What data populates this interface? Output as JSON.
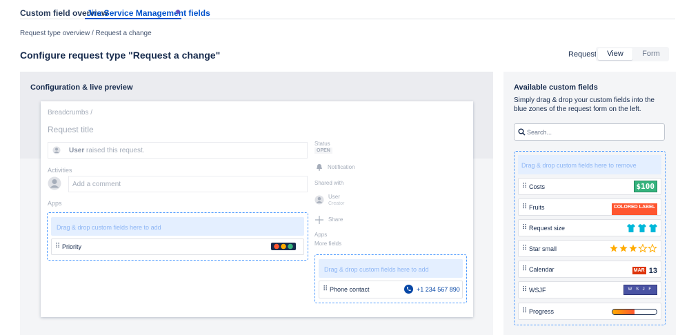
{
  "tabs": {
    "overview": "Custom field overview",
    "jsm": "Jira Service Management fields"
  },
  "breadcrumb": "Request type overview / Request a change",
  "page_title": "Configure request type \"Request a change\"",
  "request_toggle": {
    "label": "Request:",
    "view": "View",
    "form": "Form"
  },
  "config": {
    "title": "Configuration & live preview",
    "preview": {
      "breadcrumbs": "Breadcrumbs /",
      "request_title": "Request title",
      "user_name": "User",
      "user_action": " raised this request.",
      "activities": "Activities",
      "comment_placeholder": "Add a comment",
      "apps": "Apps",
      "dropzone_hint": "Drag & drop custom fields here to add",
      "priority_field": "Priority",
      "status_label": "Status",
      "status_value": "OPEN",
      "notification": "Notification",
      "shared_with": "Shared with",
      "shared_user": "User",
      "shared_role": "Creator",
      "share": "Share",
      "apps2": "Apps",
      "more_fields": "More fields",
      "side_dropzone_hint": "Drag & drop custom fields here to add",
      "phone_field": "Phone contact",
      "phone_value": "+1 234 567 890"
    }
  },
  "available": {
    "title": "Available custom fields",
    "description": "Simply drag & drop your custom fields into the blue zones of the request form on the left.",
    "search_placeholder": "Search...",
    "remove_hint": "Drag & drop custom fields here to remove",
    "fields": [
      {
        "label": "Costs",
        "widget": "$100"
      },
      {
        "label": "Fruits",
        "widget": "COLORED LABEL"
      },
      {
        "label": "Request size"
      },
      {
        "label": "Star small",
        "rating": 3,
        "max": 5
      },
      {
        "label": "Calendar",
        "month": "MAR",
        "day": "13"
      },
      {
        "label": "WSJF",
        "widget": "W S J F"
      },
      {
        "label": "Progress",
        "progress": 0.5
      }
    ]
  },
  "colors": {
    "accent": "#0052cc",
    "dropzone": "#4c9aff",
    "star": "#ffab00",
    "shirt": "#00b8d9"
  }
}
